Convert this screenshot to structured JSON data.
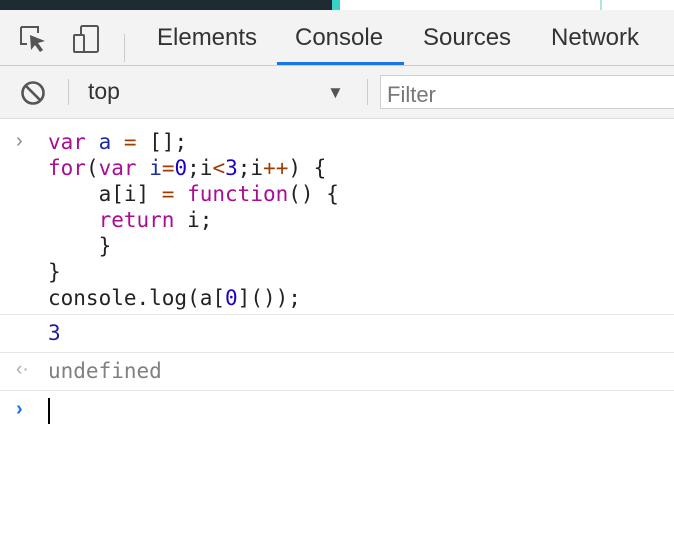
{
  "topbar": {
    "inspect_icon": "inspect-element-icon",
    "device_icon": "device-toggle-icon"
  },
  "tabs": [
    {
      "label": "Elements",
      "active": false
    },
    {
      "label": "Console",
      "active": true
    },
    {
      "label": "Sources",
      "active": false
    },
    {
      "label": "Network",
      "active": false
    }
  ],
  "toolbar": {
    "clear_icon": "clear-console-icon",
    "context": "top",
    "filter_placeholder": "Filter"
  },
  "console": {
    "input_lines": [
      "var a = [];",
      "for(var i=0;i<3;i++) {",
      "    a[i] = function() {",
      "    return i;",
      "    }",
      "}",
      "console.log(a[0]());"
    ],
    "log_output": "3",
    "return_value": "undefined"
  },
  "colors": {
    "accent": "#1a73e8",
    "keyword": "#aa0d91",
    "number": "#1c00cf"
  }
}
